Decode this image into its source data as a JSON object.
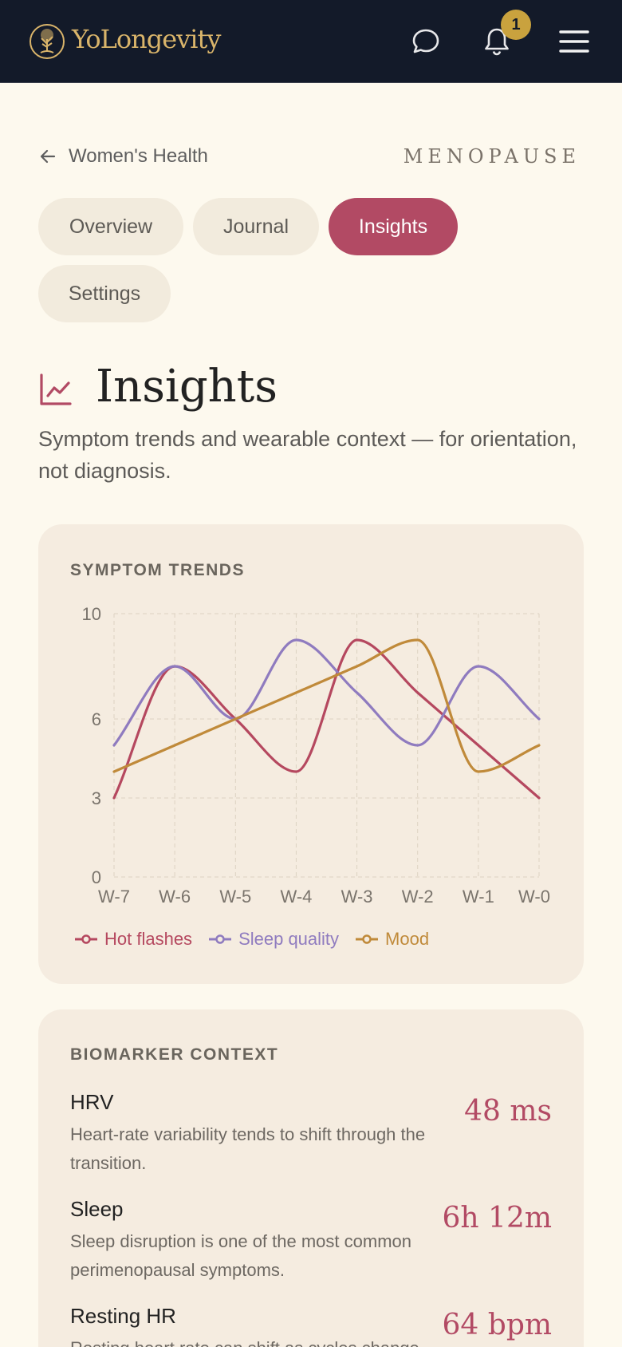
{
  "header": {
    "brand": "YoLongevity",
    "notification_count": "1",
    "icons": [
      "tree-logo-icon",
      "chat-icon",
      "bell-icon",
      "menu-icon"
    ]
  },
  "breadcrumb": {
    "back_label": "Women's Health",
    "section": "MENOPAUSE"
  },
  "tabs": [
    {
      "label": "Overview",
      "active": false
    },
    {
      "label": "Journal",
      "active": false
    },
    {
      "label": "Insights",
      "active": true
    },
    {
      "label": "Settings",
      "active": false
    }
  ],
  "page": {
    "title": "Insights",
    "subtitle": "Symptom trends and wearable context — for orientation, not diagnosis."
  },
  "colors": {
    "accent": "#b24a64",
    "hot_flashes": "#b5485f",
    "sleep_quality": "#8f7bbf",
    "mood": "#c08a3a",
    "header_bg": "#131a29",
    "brand_gold": "#d9b46a"
  },
  "trends_card": {
    "label": "SYMPTOM TRENDS"
  },
  "chart_data": {
    "type": "line",
    "title": "SYMPTOM TRENDS",
    "xlabel": "",
    "ylabel": "",
    "categories": [
      "W-7",
      "W-6",
      "W-5",
      "W-4",
      "W-3",
      "W-2",
      "W-1",
      "W-0"
    ],
    "y_ticks": [
      "0",
      "3",
      "6",
      "10"
    ],
    "ylim": [
      0,
      10
    ],
    "grid": true,
    "legend_position": "bottom",
    "series": [
      {
        "name": "Hot flashes",
        "values": [
          3,
          8,
          6,
          4,
          9,
          7,
          5,
          3
        ]
      },
      {
        "name": "Sleep quality",
        "values": [
          5,
          8,
          6,
          9,
          7,
          5,
          8,
          6
        ]
      },
      {
        "name": "Mood",
        "values": [
          4,
          5,
          6,
          7,
          8,
          9,
          4,
          5
        ]
      }
    ]
  },
  "biomarkers": {
    "label": "BIOMARKER CONTEXT",
    "items": [
      {
        "name": "HRV",
        "value": "48 ms",
        "desc": "Heart-rate variability tends to shift through the transition."
      },
      {
        "name": "Sleep",
        "value": "6h 12m",
        "desc": "Sleep disruption is one of the most common perimenopausal symptoms."
      },
      {
        "name": "Resting HR",
        "value": "64 bpm",
        "desc": "Resting heart rate can shift as cycles change."
      }
    ]
  }
}
